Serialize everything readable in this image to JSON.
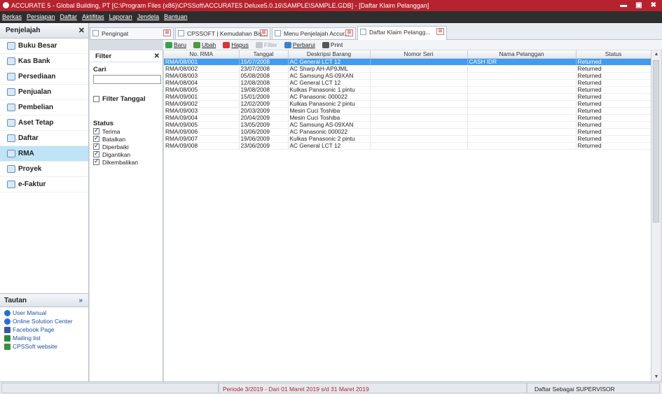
{
  "window": {
    "title": "ACCURATE 5 - Global Building, PT  [C:\\Program Files (x86)\\CPSSoft\\ACCURATE5 Deluxe5.0.16\\SAMPLE\\SAMPLE.GDB] - [Daftar Klaim Pelanggan]",
    "controls": [
      "▬",
      "▣",
      "✖"
    ]
  },
  "menu": [
    "Berkas",
    "Persiapan",
    "Daftar",
    "Aktifitas",
    "Laporan",
    "Jendela",
    "Bantuan"
  ],
  "sidebar": {
    "title": "Penjelajah",
    "close": "✕",
    "items": [
      {
        "label": "Buku Besar",
        "active": false
      },
      {
        "label": "Kas Bank",
        "active": false
      },
      {
        "label": "Persediaan",
        "active": false
      },
      {
        "label": "Penjualan",
        "active": false
      },
      {
        "label": "Pembelian",
        "active": false
      },
      {
        "label": "Aset Tetap",
        "active": false
      },
      {
        "label": "Daftar",
        "active": false
      },
      {
        "label": "RMA",
        "active": true
      },
      {
        "label": "Proyek",
        "active": false
      },
      {
        "label": "e-Faktur",
        "active": false
      }
    ],
    "tautan_title": "Tautan",
    "tautan_chev": "»",
    "links": [
      "User Manual",
      "Online Solution Center",
      "Facebook Page",
      "Mailing list",
      "CPSSoft website"
    ]
  },
  "tabs": [
    {
      "label": "Pengingat",
      "close": "⊠"
    },
    {
      "label": "CPSSOFT | Kemudahan Bis...",
      "close": "⊠"
    },
    {
      "label": "Menu Penjelajah Accur...",
      "close": "⊠"
    },
    {
      "label": "Daftar Klaim Pelangg...",
      "close": "⊠"
    }
  ],
  "toolbar": {
    "baru": "Baru",
    "ubah": "Ubah",
    "hapus": "Hapus",
    "filter": "Filter",
    "perbarui": "Perbarui",
    "print": "Print"
  },
  "filter": {
    "title": "Filter",
    "close": "✕",
    "cari_label": "Cari",
    "cari_value": "",
    "filter_tanggal": "Filter Tanggal",
    "status_label": "Status",
    "statuses": [
      "Terima",
      "Batalkan",
      "Diperbaiki",
      "Digantikan",
      "Dikembalikan"
    ]
  },
  "table": {
    "columns": [
      "No. RMA",
      "Tanggal",
      "Deskripsi Barang",
      "Nomor Seri",
      "Nama Pelanggan",
      "Status"
    ],
    "rows": [
      [
        "RMA/08/001",
        "15/07/2008",
        "AC General LCT 12",
        "",
        "CASH IDR",
        "Returned"
      ],
      [
        "RMA/08/002",
        "23/07/2008",
        "AC Sharp AH-AP9JML",
        "",
        "",
        "Returned"
      ],
      [
        "RMA/08/003",
        "05/08/2008",
        "AC Samsung AS-09XAN",
        "",
        "",
        "Returned"
      ],
      [
        "RMA/08/004",
        "12/08/2008",
        "AC General LCT 12",
        "",
        "",
        "Returned"
      ],
      [
        "RMA/08/005",
        "19/08/2008",
        "Kulkas Panasonic 1 pintu",
        "",
        "",
        "Returned"
      ],
      [
        "RMA/09/001",
        "15/01/2009",
        "AC Panasonic 000022",
        "",
        "",
        "Returned"
      ],
      [
        "RMA/09/002",
        "12/02/2009",
        "Kulkas Panasonic 2 pintu",
        "",
        "",
        "Returned"
      ],
      [
        "RMA/09/003",
        "20/03/2009",
        "Mesin Cuci Toshiba",
        "",
        "",
        "Returned"
      ],
      [
        "RMA/09/004",
        "20/04/2009",
        "Mesin Cuci Toshiba",
        "",
        "",
        "Returned"
      ],
      [
        "RMA/09/005",
        "13/05/2009",
        "AC Samsung AS-09XAN",
        "",
        "",
        "Returned"
      ],
      [
        "RMA/09/006",
        "10/06/2009",
        "AC Panasonic 000022",
        "",
        "",
        "Returned"
      ],
      [
        "RMA/09/007",
        "19/06/2009",
        "Kulkas Panasonic 2 pintu",
        "",
        "",
        "Returned"
      ],
      [
        "RMA/09/008",
        "23/06/2009",
        "AC General LCT 12",
        "",
        "",
        "Returned"
      ]
    ]
  },
  "scroll": {
    "up": "▲",
    "down": "▼"
  },
  "statusbar": {
    "period": "Periode 3/2019 - Dari 01 Maret 2019 s/d 31 Maret 2019",
    "user": "Daftar Sebagai SUPERVISOR"
  },
  "colors": {
    "titlebar": "#b5232e",
    "menubar": "#2e2e2e",
    "selection": "#3f9cf0",
    "active_nav": "#bfe3f7"
  }
}
